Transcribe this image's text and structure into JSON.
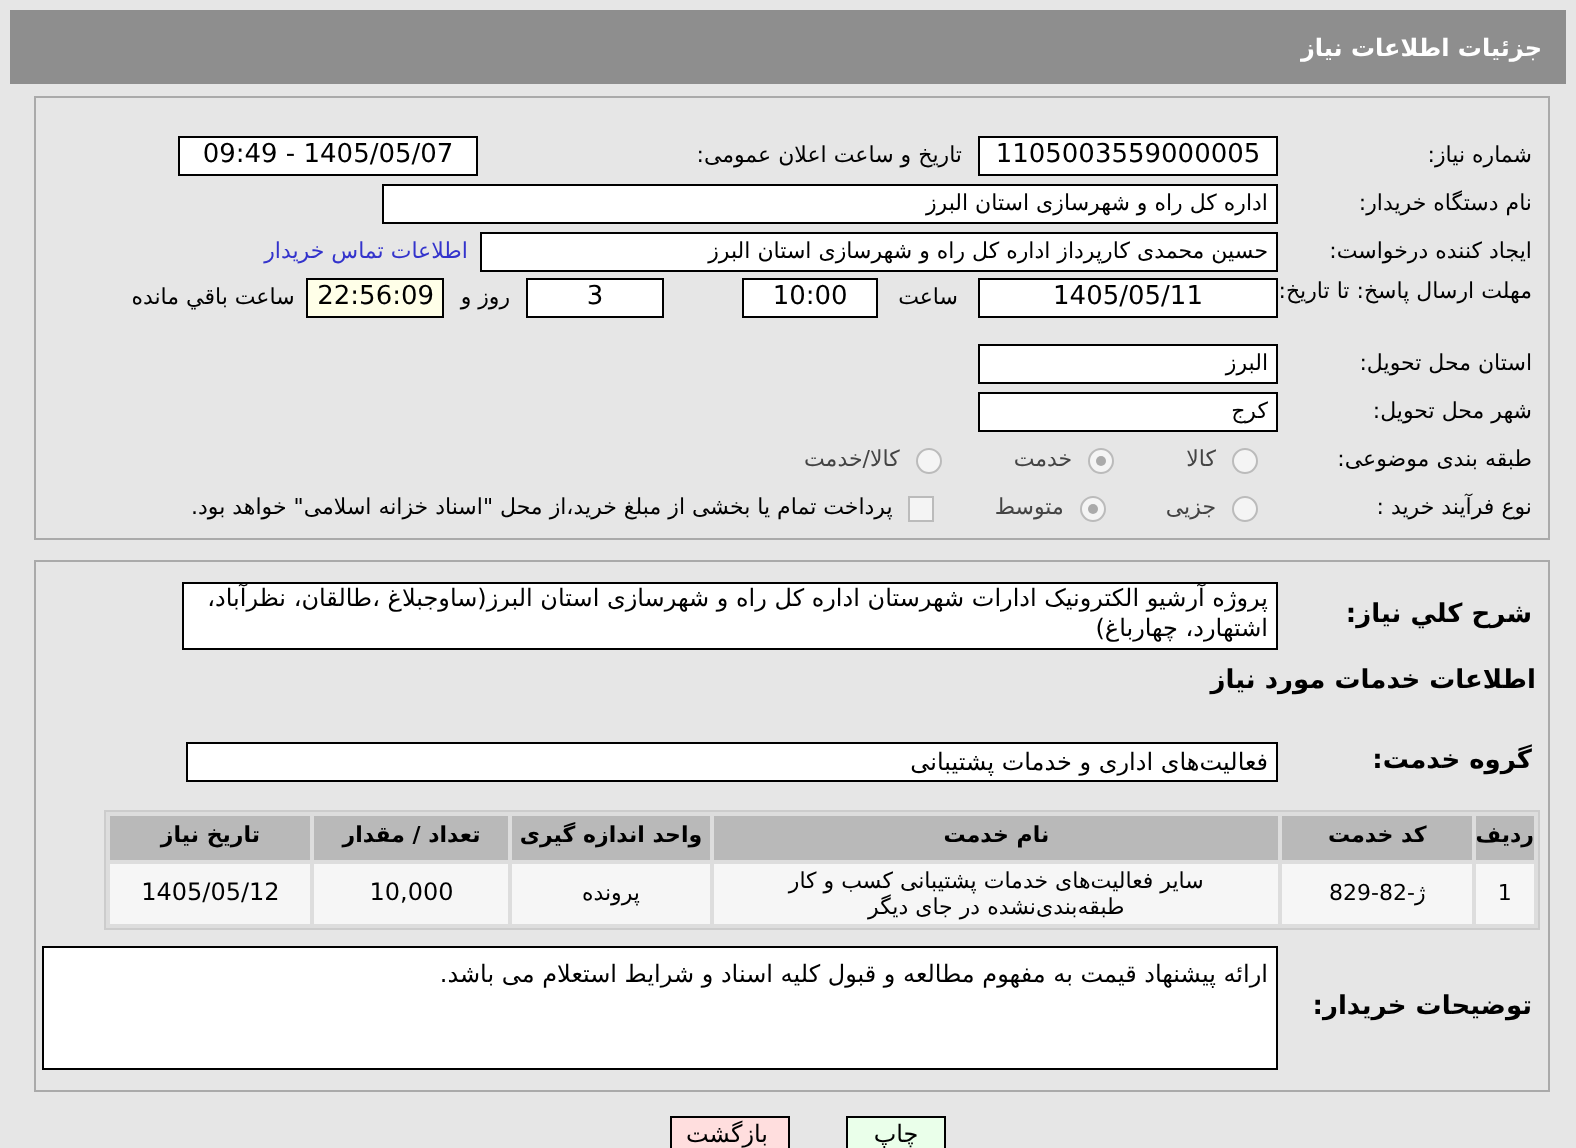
{
  "header": {
    "title": "جزئیات اطلاعات نیاز"
  },
  "need_number": {
    "label": "شماره نیاز:",
    "value": "1105003559000005"
  },
  "announce": {
    "label": "تاریخ و ساعت اعلان عمومی:",
    "value": "1405/05/07 - 09:49"
  },
  "buyer_org": {
    "label": "نام دستگاه خریدار:",
    "value": "اداره کل راه و شهرسازی استان البرز"
  },
  "requester": {
    "label": "ایجاد کننده درخواست:",
    "value": "حسین محمدی کارپرداز اداره کل راه و شهرسازی استان البرز",
    "link": "اطلاعات تماس خریدار"
  },
  "deadline": {
    "label": "مهلت ارسال پاسخ: تا تاریخ:",
    "date": "1405/05/11",
    "time_label": "ساعت",
    "time": "10:00",
    "days": "3",
    "days_label": "روز و",
    "remaining": "22:56:09",
    "remaining_label": "ساعت باقي مانده"
  },
  "province": {
    "label": "استان محل تحویل:",
    "value": "البرز"
  },
  "city": {
    "label": "شهر محل تحویل:",
    "value": "کرج"
  },
  "category": {
    "label": "طبقه بندی موضوعی:",
    "options": [
      {
        "label": "کالا",
        "selected": false
      },
      {
        "label": "خدمت",
        "selected": true
      },
      {
        "label": "کالا/خدمت",
        "selected": false
      }
    ]
  },
  "process": {
    "label": "نوع فرآیند خرید :",
    "options": [
      {
        "label": "جزیی",
        "selected": false
      },
      {
        "label": "متوسط",
        "selected": true
      }
    ],
    "treasury": {
      "checked": false,
      "text": "پرداخت تمام یا بخشی از مبلغ خرید،از محل \"اسناد خزانه اسلامی\" خواهد بود."
    }
  },
  "description": {
    "label": "شرح کلي نیاز:",
    "value": "پروژه آرشیو الکترونیک ادارات شهرستان اداره کل راه و شهرسازی استان البرز(ساوجبلاغ ،طالقان، نظرآباد، اشتهارد، چهارباغ)"
  },
  "services_heading": "اطلاعات خدمات مورد نیاز",
  "service_group": {
    "label": "گروه خدمت:",
    "value": "فعالیت‌های اداری و خدمات پشتیبانی"
  },
  "table": {
    "columns": [
      "ردیف",
      "کد خدمت",
      "نام خدمت",
      "واحد اندازه گیری",
      "تعداد / مقدار",
      "تاریخ نیاز"
    ],
    "rows": [
      [
        "1",
        "ژ-82-829",
        "سایر فعالیت‌های خدمات پشتیبانی کسب و کار طبقه‌بندی‌نشده در جای دیگر",
        "پرونده",
        "10,000",
        "1405/05/12"
      ]
    ]
  },
  "buyer_notes": {
    "label": "توضیحات خریدار:",
    "value": "ارائه پیشنهاد قیمت به مفهوم مطالعه و قبول کلیه اسناد و شرایط استعلام می باشد."
  },
  "buttons": [
    {
      "label": "چاپ",
      "kind": "print"
    },
    {
      "label": "بازگشت",
      "kind": "back"
    }
  ]
}
